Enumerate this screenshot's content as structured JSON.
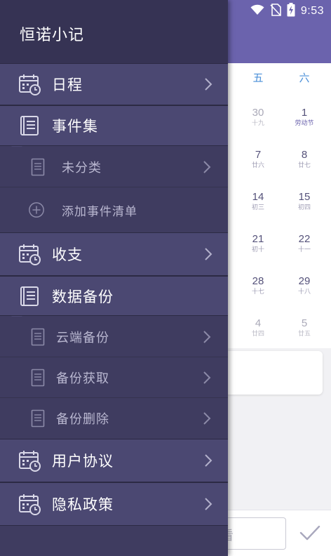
{
  "status_bar": {
    "time": "9:53"
  },
  "background_calendar": {
    "weekdays": [
      "五",
      "六"
    ],
    "days": [
      {
        "num": "30",
        "lunar": "十九",
        "col": 0,
        "row": 0,
        "dim": true
      },
      {
        "num": "1",
        "lunar": "劳动节",
        "col": 1,
        "row": 0,
        "holiday": true
      },
      {
        "num": "7",
        "lunar": "廿六",
        "col": 0,
        "row": 1
      },
      {
        "num": "8",
        "lunar": "廿七",
        "col": 1,
        "row": 1
      },
      {
        "num": "14",
        "lunar": "初三",
        "col": 0,
        "row": 2
      },
      {
        "num": "15",
        "lunar": "初四",
        "col": 1,
        "row": 2
      },
      {
        "num": "21",
        "lunar": "初十",
        "col": 0,
        "row": 3
      },
      {
        "num": "22",
        "lunar": "十一",
        "col": 1,
        "row": 3
      },
      {
        "num": "28",
        "lunar": "十七",
        "col": 0,
        "row": 4
      },
      {
        "num": "29",
        "lunar": "十八",
        "col": 1,
        "row": 4
      },
      {
        "num": "4",
        "lunar": "廿四",
        "col": 0,
        "row": 5,
        "dim": true
      },
      {
        "num": "5",
        "lunar": "廿五",
        "col": 1,
        "row": 5,
        "dim": true
      }
    ],
    "input_fragment": "看"
  },
  "drawer": {
    "title": "恒诺小记",
    "items": {
      "schedule": {
        "label": "日程",
        "icon": "calendar-clock-icon"
      },
      "event_sets": {
        "label": "事件集",
        "icon": "notebook-icon"
      },
      "uncategorized": {
        "label": "未分类",
        "icon": "document-icon"
      },
      "add_event_list": {
        "label": "添加事件清单",
        "icon": "plus-circle-icon"
      },
      "income_expense": {
        "label": "收支",
        "icon": "calendar-clock-icon"
      },
      "data_backup": {
        "label": "数据备份",
        "icon": "notebook-icon"
      },
      "cloud_backup": {
        "label": "云端备份",
        "icon": "document-icon"
      },
      "backup_fetch": {
        "label": "备份获取",
        "icon": "document-icon"
      },
      "backup_delete": {
        "label": "备份删除",
        "icon": "document-icon"
      },
      "user_agreement": {
        "label": "用户协议",
        "icon": "calendar-clock-icon"
      },
      "privacy_policy": {
        "label": "隐私政策",
        "icon": "calendar-clock-icon"
      }
    }
  },
  "colors": {
    "drawer_bg": "#3f3c60",
    "drawer_header": "#363354",
    "menu_item_bg": "#4b4872",
    "accent_purple": "#6b63ad",
    "weekday_blue": "#4a8fd8"
  }
}
